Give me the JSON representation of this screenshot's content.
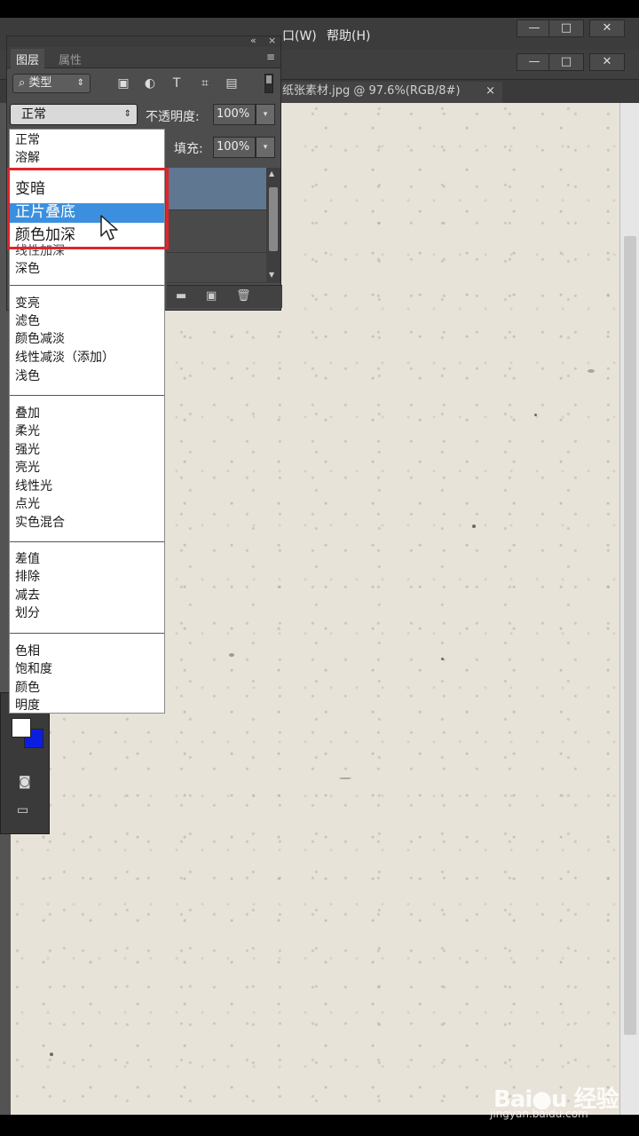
{
  "menubar": {
    "items": [
      "彩(W)",
      "帮助(H)"
    ],
    "item0_display": "口(W)",
    "window_buttons": [
      "—",
      "□",
      "✕"
    ]
  },
  "document": {
    "tab_title": "纸张素材.jpg @ 97.6%(RGB/8#)",
    "close": "×"
  },
  "layers_panel": {
    "tabs": [
      "图层",
      "属性"
    ],
    "collapse": "«",
    "close": "×",
    "menu": "≡",
    "filter_label": "⌕ 类型",
    "blend_mode": "正常",
    "opacity_label": "不透明度:",
    "opacity_value": "100%",
    "fill_label": "填充:",
    "fill_value": "100%"
  },
  "blend_dropdown": {
    "groups": [
      [
        "正常",
        "溶解"
      ],
      [
        "变暗",
        "正片叠底",
        "颜色加深",
        "线性加深",
        "深色"
      ],
      [
        "变亮",
        "滤色",
        "颜色减淡",
        "线性减淡（添加）",
        "浅色"
      ],
      [
        "叠加",
        "柔光",
        "强光",
        "亮光",
        "线性光",
        "点光",
        "实色混合"
      ],
      [
        "差值",
        "排除",
        "减去",
        "划分"
      ],
      [
        "色相",
        "饱和度",
        "颜色",
        "明度"
      ]
    ],
    "highlighted": "正片叠底"
  },
  "watermark": {
    "brand": "Bai●u 经验",
    "url": "jingyan.baidu.com"
  },
  "colors": {
    "highlight": "#3b8fde",
    "callout": "#e0242c",
    "background_swatch": "#0b1ee0"
  }
}
